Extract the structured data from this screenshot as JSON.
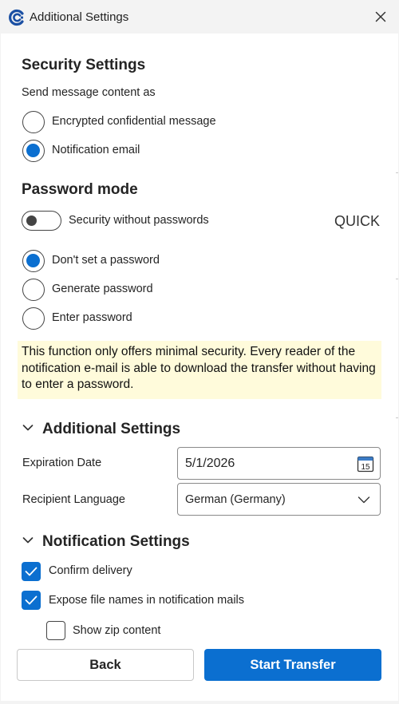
{
  "window": {
    "title": "Additional Settings"
  },
  "security": {
    "heading": "Security Settings",
    "send_label": "Send message content as",
    "options": [
      {
        "label": "Encrypted confidential message",
        "selected": false
      },
      {
        "label": "Notification email",
        "selected": true
      }
    ]
  },
  "password": {
    "heading": "Password mode",
    "toggle_label": "Security without passwords",
    "toggle_on": false,
    "badge": "QUICK",
    "options": [
      {
        "label": "Don't set a password",
        "selected": true
      },
      {
        "label": "Generate password",
        "selected": false
      },
      {
        "label": "Enter password",
        "selected": false
      }
    ],
    "info": "This function only offers minimal security. Every reader of the notification e-mail is able to download the transfer without having to enter a password."
  },
  "additional": {
    "heading": "Additional Settings",
    "expiration_label": "Expiration Date",
    "expiration_value": "5/1/2026",
    "calendar_day": "15",
    "language_label": "Recipient Language",
    "language_value": "German (Germany)"
  },
  "notification": {
    "heading": "Notification Settings",
    "options": [
      {
        "label": "Confirm delivery",
        "checked": true
      },
      {
        "label": "Expose file names in notification mails",
        "checked": true
      },
      {
        "label": "Show zip content",
        "checked": false
      }
    ]
  },
  "footer": {
    "back_label": "Back",
    "start_label": "Start Transfer"
  },
  "colors": {
    "accent": "#0b6fd0",
    "info_bg": "#fffbdb"
  }
}
